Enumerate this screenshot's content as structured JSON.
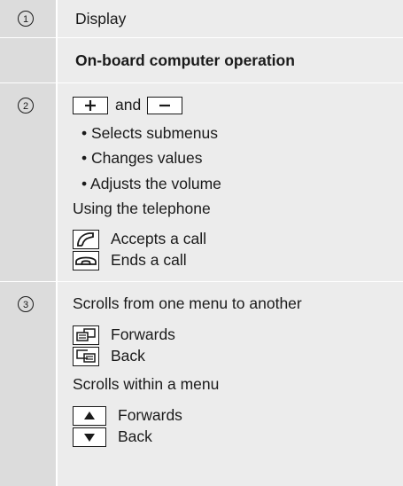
{
  "rows": [
    {
      "num": "1",
      "text": "Display"
    },
    {
      "text": "On-board computer operation"
    },
    {
      "num": "2",
      "and_text": "and",
      "bullets": [
        "• Selects submenus",
        "• Changes values",
        "• Adjusts the volume"
      ],
      "telephone_heading": "Using the telephone",
      "accept_call": "Accepts a call",
      "end_call": "Ends a call"
    },
    {
      "num": "3",
      "scroll_menus": "Scrolls from one menu to another",
      "forwards_1": "Forwards",
      "back_1": "Back",
      "scroll_within": "Scrolls within a menu",
      "forwards_2": "Forwards",
      "back_2": "Back"
    }
  ],
  "icons": [
    "plus-icon",
    "minus-icon",
    "phone-accept-icon",
    "phone-end-icon",
    "page-forward-icon",
    "page-back-icon",
    "arrow-up-icon",
    "arrow-down-icon"
  ]
}
